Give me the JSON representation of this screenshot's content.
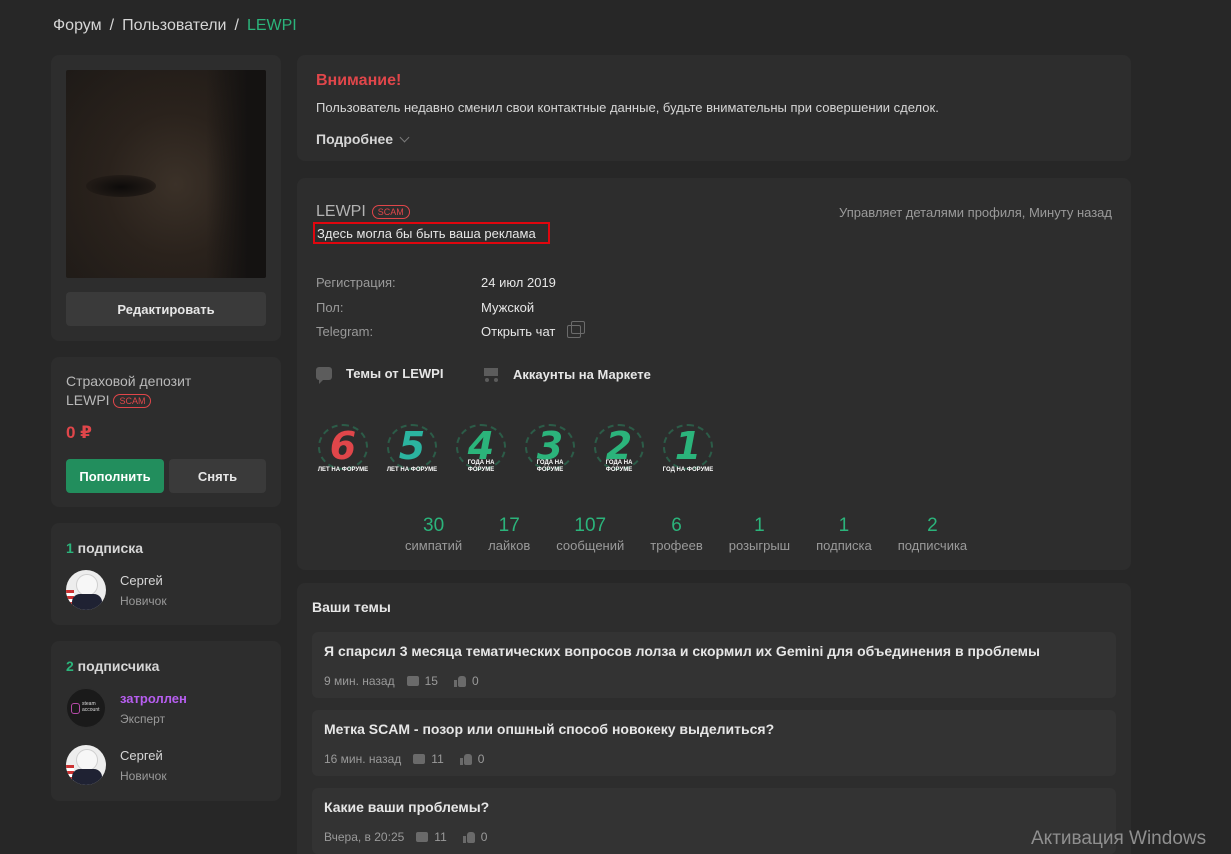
{
  "breadcrumb": {
    "forum": "Форум",
    "sep1": "/",
    "users": "Пользователи",
    "sep2": "/",
    "current": "LEWPI"
  },
  "sidebar": {
    "edit_button": "Редактировать",
    "deposit": {
      "title": "Страховой депозит",
      "name": "LEWPI",
      "scam_badge": "SCAM",
      "amount": "0 ₽",
      "topup": "Пополнить",
      "withdraw": "Снять"
    },
    "subscriptions": {
      "count": "1",
      "label": " подписка",
      "people": [
        {
          "name": "Сергей",
          "role": "Новичок"
        }
      ]
    },
    "followers": {
      "count": "2",
      "label": " подписчика",
      "people": [
        {
          "name": "затроллен",
          "role": "Эксперт",
          "avatar_text": "steam account"
        },
        {
          "name": "Сергей",
          "role": "Новичок"
        }
      ]
    }
  },
  "alert": {
    "title": "Внимание!",
    "text": "Пользователь недавно сменил свои контактные данные, будьте внимательны при совершении сделок.",
    "more": "Подробнее"
  },
  "profile": {
    "name": "LEWPI",
    "scam_badge": "SCAM",
    "status": "Здесь могла бы быть ваша реклама",
    "activity": "Управляет деталями профиля, Минуту назад",
    "info": [
      {
        "label": "Регистрация:",
        "value": "24 июл 2019"
      },
      {
        "label": "Пол:",
        "value": "Мужской"
      },
      {
        "label": "Telegram:",
        "value": "Открыть чат"
      }
    ],
    "links": {
      "threads": "Темы от LEWPI",
      "market": "Аккаунты на Маркете"
    },
    "trophies": [
      {
        "num": "6",
        "sub": "ЛЕТ НА ФОРУМЕ",
        "color": "#e0464a"
      },
      {
        "num": "5",
        "sub": "ЛЕТ НА ФОРУМЕ",
        "color": "#2bb4a0"
      },
      {
        "num": "4",
        "sub": "ГОДА НА ФОРУМЕ",
        "color": "#2bb47b"
      },
      {
        "num": "3",
        "sub": "ГОДА НА ФОРУМЕ",
        "color": "#2bb47b"
      },
      {
        "num": "2",
        "sub": "ГОДА НА ФОРУМЕ",
        "color": "#2bb47b"
      },
      {
        "num": "1",
        "sub": "ГОД НА ФОРУМЕ",
        "color": "#2bb47b"
      }
    ],
    "stats": [
      {
        "value": "30",
        "label": "симпатий"
      },
      {
        "value": "17",
        "label": "лайков"
      },
      {
        "value": "107",
        "label": "сообщений"
      },
      {
        "value": "6",
        "label": "трофеев"
      },
      {
        "value": "1",
        "label": "розыгрыш"
      },
      {
        "value": "1",
        "label": "подписка"
      },
      {
        "value": "2",
        "label": "подписчика"
      }
    ]
  },
  "threads": {
    "title": "Ваши темы",
    "items": [
      {
        "title": "Я спарсил 3 месяца тематических вопросов лолза и скормил их Gemini для объединения в проблемы",
        "time": "9 мин. назад",
        "replies": "15",
        "likes": "0"
      },
      {
        "title": "Метка SCAM - позор или опшный способ новокеку выделиться?",
        "time": "16 мин. назад",
        "replies": "11",
        "likes": "0"
      },
      {
        "title": "Какие ваши проблемы?",
        "time": "Вчера, в 20:25",
        "replies": "11",
        "likes": "0"
      }
    ]
  },
  "watermark": "Активация Windows"
}
